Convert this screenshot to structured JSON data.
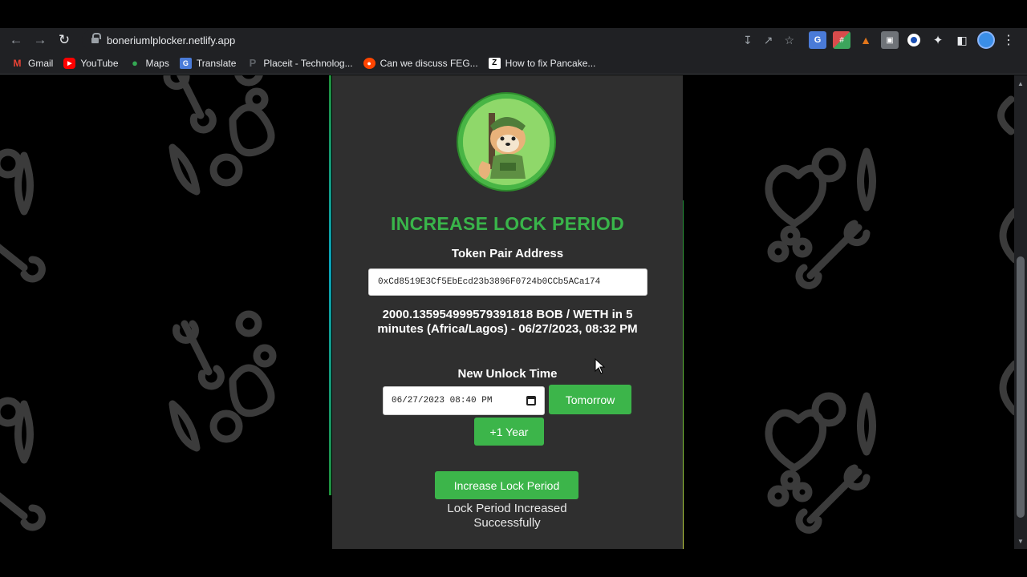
{
  "browser": {
    "url": "boneriumlplocker.netlify.app",
    "bookmarks": [
      {
        "label": "Gmail",
        "icon": "gmail-icon"
      },
      {
        "label": "YouTube",
        "icon": "youtube-icon"
      },
      {
        "label": "Maps",
        "icon": "maps-icon"
      },
      {
        "label": "Translate",
        "icon": "translate-icon"
      },
      {
        "label": "Placeit - Technolog...",
        "icon": "placeit-icon"
      },
      {
        "label": "Can we discuss FEG...",
        "icon": "reddit-icon"
      },
      {
        "label": "How to fix Pancake...",
        "icon": "z-icon"
      }
    ],
    "bookmark_icon_glyphs": {
      "gmail": "M",
      "youtube": "▶",
      "maps": "●",
      "translate": "G",
      "placeit": "P",
      "reddit": "●",
      "z": "Z"
    }
  },
  "page": {
    "heading": "INCREASE LOCK PERIOD",
    "token_pair_label": "Token Pair Address",
    "token_pair_address": "0xCd8519E3Cf5EbEcd23b3896F0724b0CCb5ACa174",
    "lock_info": "2000.135954999579391818 BOB / WETH in 5 minutes (Africa/Lagos) - 06/27/2023, 08:32 PM",
    "new_unlock_label": "New Unlock Time",
    "new_unlock_value": "06/27/2023 08:40 PM",
    "tomorrow_button": "Tomorrow",
    "plus_year_button": "+1 Year",
    "increase_button": "Increase Lock Period",
    "status_message": "Lock Period Increased Successfully"
  },
  "colors": {
    "accent_green": "#3cb54a",
    "heading_green": "#39b54a",
    "card_bg": "#2f2f2f",
    "page_bg": "#000000"
  }
}
